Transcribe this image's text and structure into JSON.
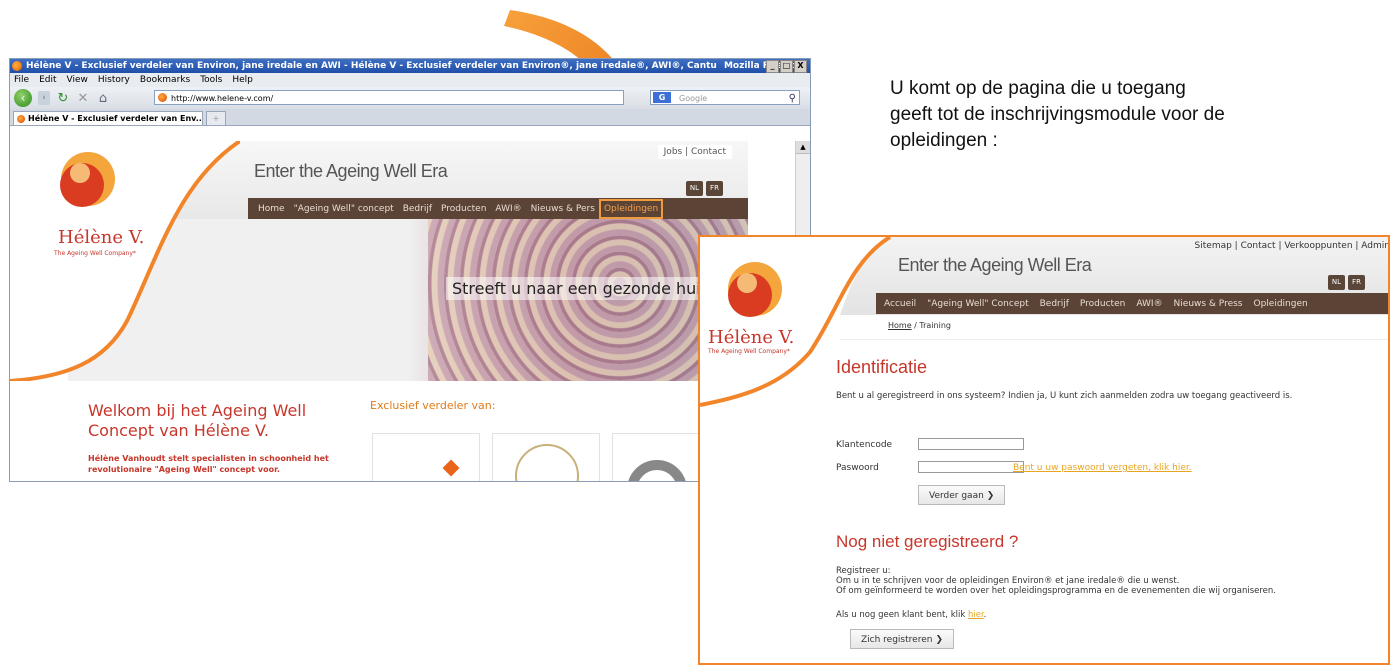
{
  "browser": {
    "title": "Hélène V - Exclusief verdeler van Environ, jane iredale en AWI - Hélène V - Exclusief verdeler van Environ®, jane iredale®, AWI®, Cantu",
    "title_suffix": "Mozilla Firefox",
    "window_buttons": [
      "_",
      "□",
      "X"
    ],
    "menu": [
      "File",
      "Edit",
      "View",
      "History",
      "Bookmarks",
      "Tools",
      "Help"
    ],
    "url": "http://www.helene-v.com/",
    "search_placeholder": "Google",
    "search_engine_icon": "G",
    "tab_label": "Hélène V - Exclusief verdeler van Env...",
    "new_tab_label": "+"
  },
  "site_left": {
    "top_links": "Jobs | Contact",
    "tagline": "Enter the Ageing Well Era",
    "lang": [
      "NL",
      "FR"
    ],
    "menu": [
      "Home",
      "\"Ageing Well\" concept",
      "Bedrijf",
      "Producten",
      "AWI®",
      "Nieuws & Pers",
      "Opleidingen"
    ],
    "highlighted_menu": "Opleidingen",
    "logo_name": "Hélène V.",
    "logo_sub": "The Ageing Well Company*",
    "hero_text": "Streeft u naar een gezonde hui",
    "welcome_title": "Welkom bij het Ageing Well Concept van Hélène V.",
    "welcome_sub": "Hélène Vanhoudt stelt specialisten in schoonheid het revolutionaire \"Ageing Well\" concept voor.",
    "exclusive": "Exclusief verdeler van:"
  },
  "caption": "U komt op de pagina die u toegang geeft tot de inschrijvingsmodule voor de opleidingen :",
  "site_right": {
    "top_links": "Sitemap | Contact | Verkooppunten | Admin",
    "tagline": "Enter the Ageing Well Era",
    "lang": [
      "NL",
      "FR"
    ],
    "menu": [
      "Accueil",
      "\"Ageing Well\" Concept",
      "Bedrijf",
      "Producten",
      "AWI®",
      "Nieuws & Press",
      "Opleidingen"
    ],
    "breadcrumb_home": "Home",
    "breadcrumb_rest": " / Training",
    "logo_name": "Hélène V.",
    "logo_sub": "The Ageing Well Company*",
    "id_title": "Identificatie",
    "id_intro": "Bent u al geregistreerd in ons systeem? Indien ja, U kunt zich aanmelden zodra uw toegang geactiveerd is.",
    "label_klantencode": "Klantencode",
    "label_paswoord": "Paswoord",
    "klantencode_value": "",
    "paswoord_value": "",
    "forgot_link": "Bent u uw paswoord vergeten, klik hier.",
    "verder_button": "Verder gaan",
    "nog_title": "Nog niet geregistreerd ?",
    "register_lines": [
      "Registreer u:",
      "Om u in te schrijven voor de opleidingen Environ® et jane iredale® die u wenst.",
      "Of om geïnformeerd te worden over het opleidingsprogramma en de evenementen die wij organiseren."
    ],
    "not_client_prefix": "Als u nog geen klant bent, klik ",
    "not_client_link": "hier",
    "not_client_suffix": ".",
    "register_button": "Zich registreren"
  },
  "colors": {
    "brand_red": "#c7362a",
    "menu_brown": "#5b4336",
    "highlight_orange": "#f2852a",
    "link_yellow": "#e8a520"
  }
}
